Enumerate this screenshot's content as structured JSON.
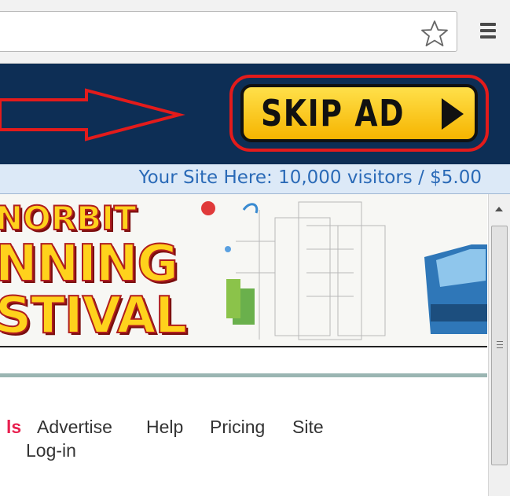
{
  "browser": {
    "bookmark_icon": "star-icon",
    "menu_icon": "hamburger-menu-icon"
  },
  "ad": {
    "skip_label": "SKIP AD",
    "skip_icon": "play-arrow-icon",
    "highlight_color": "#e31b1b",
    "button_color": "#f6b400",
    "bar_color": "#0d2e55"
  },
  "promo": {
    "text": "Your Site Here: 10,000 visitors / $5.00"
  },
  "banner": {
    "line1": "NORBIT",
    "line2": "NNING",
    "line3": "STIVAL"
  },
  "nav": {
    "partial_link": "ls",
    "advertise": "Advertise",
    "help": "Help",
    "pricing": "Pricing",
    "site": "Site",
    "login": "Log-in"
  }
}
